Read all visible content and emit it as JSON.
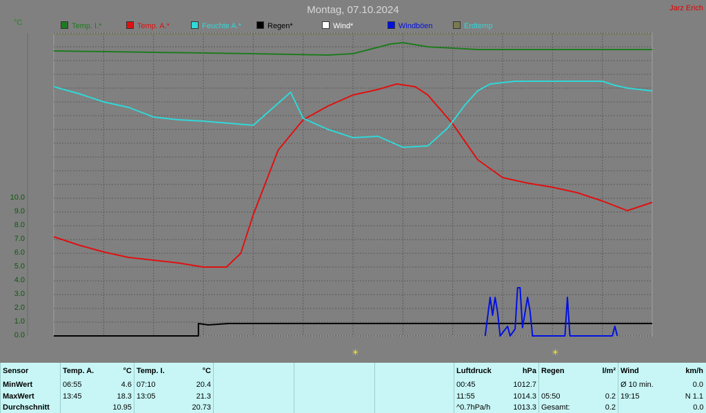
{
  "header": {
    "title": "Montag, 07.10.2024",
    "author": "Jarz Erich",
    "y_unit": "°C"
  },
  "legend": [
    {
      "label": "Temp. I.*",
      "color": "#1e7a1e"
    },
    {
      "label": "Temp. A.*",
      "color": "#e01010"
    },
    {
      "label": "Feuchte A.*",
      "color": "#30d8d8"
    },
    {
      "label": "Regen*",
      "color": "#000000"
    },
    {
      "label": "Wind*",
      "color": "#ffffff"
    },
    {
      "label": "Windböen",
      "color": "#0010e0"
    },
    {
      "label": "Erdtemp",
      "color": "#7a7a50"
    }
  ],
  "chart_data": {
    "type": "line",
    "title": "Montag, 07.10.2024",
    "ylabel": "°C",
    "ylim": [
      0,
      22
    ],
    "yticks": [
      "0.0",
      "1.0",
      "2.0",
      "3.0",
      "4.0",
      "5.0",
      "6.0",
      "7.0",
      "8.0",
      "9.0",
      "10.0"
    ],
    "x_hours": [
      0,
      24
    ],
    "grid": true,
    "sunrise_marker": "07:12",
    "sunset_marker": "18:42",
    "series": [
      {
        "name": "Temp. I.*",
        "color": "#1e7a1e",
        "x": [
          0,
          4,
          8,
          11,
          12,
          13.5,
          14,
          15,
          17,
          20,
          24
        ],
        "y": [
          20.7,
          20.6,
          20.5,
          20.4,
          20.5,
          21.2,
          21.3,
          21.0,
          20.8,
          20.8,
          20.8
        ]
      },
      {
        "name": "Temp. A.*",
        "color": "#e01010",
        "x": [
          0,
          1,
          2,
          3,
          4,
          5,
          6,
          6.92,
          7.5,
          8,
          9,
          10,
          11,
          12,
          13,
          13.75,
          14.5,
          15,
          16,
          17,
          18,
          19,
          20,
          21,
          22,
          23,
          24
        ],
        "y": [
          7.2,
          6.6,
          6.1,
          5.7,
          5.5,
          5.3,
          5.0,
          5.0,
          6.0,
          8.8,
          13.5,
          15.7,
          16.7,
          17.5,
          17.9,
          18.3,
          18.1,
          17.5,
          15.4,
          12.8,
          11.5,
          11.1,
          10.8,
          10.4,
          9.8,
          9.1,
          9.7
        ]
      },
      {
        "name": "Feuchte A.*",
        "color": "#30d8d8",
        "x": [
          0,
          1,
          2,
          3,
          4,
          5,
          6,
          8,
          9.5,
          10,
          11,
          12,
          13,
          14,
          15,
          15.8,
          16.5,
          17,
          17.5,
          18,
          18.5,
          19,
          20,
          21,
          22,
          22.5,
          23,
          24
        ],
        "y": [
          18.1,
          17.6,
          17.0,
          16.6,
          15.9,
          15.7,
          15.6,
          15.3,
          17.7,
          15.8,
          15.0,
          14.4,
          14.5,
          13.7,
          13.8,
          15.1,
          16.8,
          17.8,
          18.3,
          18.4,
          18.5,
          18.5,
          18.5,
          18.5,
          18.5,
          18.2,
          18.0,
          17.8
        ]
      },
      {
        "name": "Regen*",
        "color": "#000000",
        "x": [
          0,
          5.8,
          5.8,
          6.2,
          7,
          24
        ],
        "y": [
          0,
          0,
          0.9,
          0.8,
          0.9,
          0.9
        ]
      },
      {
        "name": "Windböen",
        "color": "#0010e0",
        "x": [
          17.3,
          17.5,
          17.6,
          17.7,
          17.8,
          17.9,
          18.2,
          18.3,
          18.5,
          18.6,
          18.7,
          18.8,
          19.0,
          19.1,
          19.2,
          19.3,
          19.5,
          20.5,
          20.6,
          20.7,
          22.4,
          22.5,
          22.6
        ],
        "y": [
          0,
          2.8,
          1.5,
          2.8,
          1.7,
          0,
          0.7,
          0,
          0.5,
          3.5,
          3.5,
          0.6,
          2.8,
          1.8,
          0,
          0,
          0,
          0,
          2.8,
          0,
          0,
          0.7,
          0
        ]
      },
      {
        "name": "Erdtemp",
        "color": "#7a7a50",
        "x": [
          0,
          24
        ],
        "y": [
          21.9,
          21.9
        ]
      }
    ]
  },
  "stats": {
    "h_sensor": "Sensor",
    "h_ta": "Temp. A.",
    "u_ta": "°C",
    "h_ti": "Temp. I.",
    "u_ti": "°C",
    "h_p": "Luftdruck",
    "u_p": "hPa",
    "h_r": "Regen",
    "u_r": "l/m²",
    "h_w": "Wind",
    "u_w": "km/h",
    "min_label": "MinWert",
    "max_label": "MaxWert",
    "avg_label": "Durchschnitt",
    "ta_min_t": "06:55",
    "ta_min_v": "4.6",
    "ta_max_t": "13:45",
    "ta_max_v": "18.3",
    "ta_avg": "10.95",
    "ti_min_t": "07:10",
    "ti_min_v": "20.4",
    "ti_max_t": "13:05",
    "ti_max_v": "21.3",
    "ti_avg": "20.73",
    "p_min_t": "00:45",
    "p_min_v": "1012.7",
    "p_max_t": "11:55",
    "p_max_v": "1014.3",
    "p_trend": "^0.7hPa/h",
    "p_avg": "1013.3",
    "r_t": "05:50",
    "r_v": "0.2",
    "r_total_label": "Gesamt:",
    "r_total": "0.2",
    "w_avg_label": "Ø 10 min.",
    "w_avg": "0.0",
    "w_max_t": "19:15",
    "w_max_v": "N 1.1",
    "w_last": "0.0"
  }
}
